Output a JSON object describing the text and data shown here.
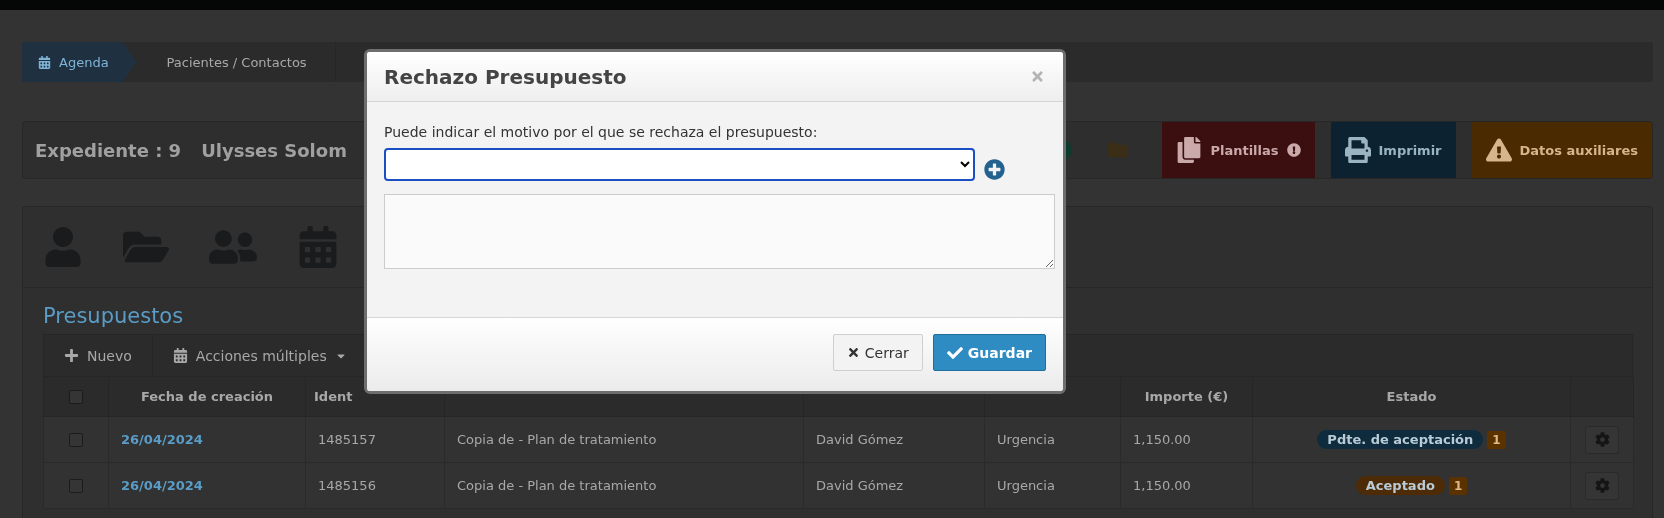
{
  "breadcrumb": [
    {
      "label": "Agenda",
      "selected": true
    },
    {
      "label": "Pacientes / Contactos",
      "selected": false
    }
  ],
  "record": {
    "title": "Expediente : 9",
    "name": "Ulysses Solom"
  },
  "action_buttons": [
    {
      "label": "Plantillas",
      "kind": "templates",
      "alert": true
    },
    {
      "label": "Imprimir",
      "kind": "print",
      "alert": false
    },
    {
      "label": "Datos auxiliares",
      "kind": "auxiliary",
      "alert": false
    }
  ],
  "section_title": "Presupuestos",
  "toolbar": [
    {
      "label": "Nuevo",
      "kind": "new"
    },
    {
      "label": "Acciones múltiples",
      "kind": "dropdown"
    }
  ],
  "table": {
    "select_all": {
      "checked": false
    },
    "columns": [
      {
        "label": "Fecha de creación"
      },
      {
        "label": "Ident"
      },
      {
        "label": "Importe (€)"
      },
      {
        "label": "Estado"
      }
    ],
    "rows": [
      {
        "checked": false,
        "date": "26/04/2024",
        "id": "1485157",
        "description": "Copia de - Plan de tratamiento",
        "professional": "David Gómez",
        "type": "Urgencia",
        "amount": "1,150.00",
        "status": {
          "label": "Pdte. de aceptación",
          "color": "#0e2c3d"
        },
        "count": "1"
      },
      {
        "checked": false,
        "date": "26/04/2024",
        "id": "1485156",
        "description": "Copia de - Plan de tratamiento",
        "professional": "David Gómez",
        "type": "Urgencia",
        "amount": "1,150.00",
        "status": {
          "label": "Aceptado",
          "color": "#4d2b06"
        },
        "count": "1"
      }
    ]
  },
  "modal": {
    "title": "Rechazo Presupuesto",
    "prompt": "Puede indicar el motivo por el que se rechaza el presupuesto:",
    "buttons": [
      {
        "label": "Cerrar",
        "kind": "close"
      },
      {
        "label": "Guardar",
        "kind": "save"
      }
    ]
  }
}
